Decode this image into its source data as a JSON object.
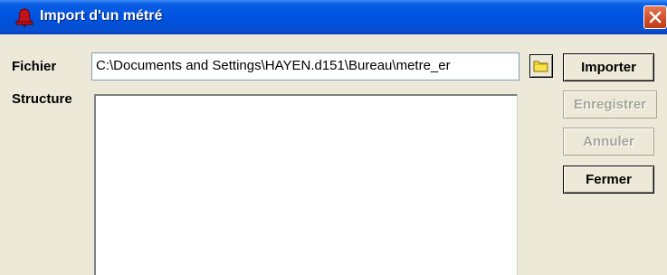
{
  "window": {
    "title": "Import d'un métré",
    "title_icon": "bell-icon",
    "close_icon": "close-icon",
    "titlebar_color": "#0053e0",
    "close_color": "#d4522f"
  },
  "form": {
    "file_label": "Fichier",
    "file_value": "C:\\Documents and Settings\\HAYEN.d151\\Bureau\\metre_er",
    "browse_icon": "folder-icon",
    "structure_label": "Structure"
  },
  "buttons": {
    "importer": "Importer",
    "enregistrer": "Enregistrer",
    "annuler": "Annuler",
    "fermer": "Fermer"
  }
}
